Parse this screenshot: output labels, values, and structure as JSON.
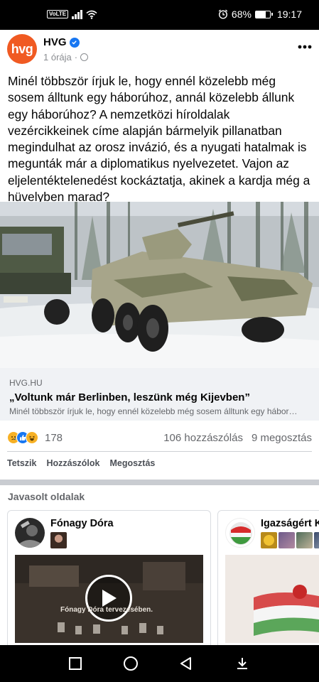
{
  "status_bar": {
    "network_label": "VoLTE",
    "battery_text": "68%",
    "battery_level": 0.68,
    "time": "19:17"
  },
  "post": {
    "author": "HVG",
    "avatar_text": "hvg",
    "time_ago": "1 órája",
    "separator": "·",
    "more_icon": "more-dots-icon",
    "text": "Minél többször írjuk le, hogy ennél közelebb még sosem álltunk egy háborúhoz, annál közelebb állunk egy háborúhoz? A nemzetközi híroldalak vezércikkeinek címe alapján bármelyik pillanatban megindulhat az orosz invázió, és a nyugati hatalmak is megunták már a diplomatikus nyelvezetet. Vajon az eljelentéktelenedést kockáztatja, akinek a kardja még a hüvelyben marad?",
    "image_icon": "armored-vehicles-photo",
    "link": {
      "domain": "HVG.HU",
      "title": "„Voltunk már Berlinben, leszünk még Kijevben”",
      "description": "Minél többször írjuk le, hogy ennél közelebb még sosem álltunk egy hábor…"
    },
    "reaction_count": "178",
    "comments_count": "106 hozzászólás",
    "shares_count": "9 megosztás",
    "actions": {
      "like": "Tetszik",
      "comment": "Hozzászólok",
      "share": "Megosztás"
    }
  },
  "suggested": {
    "title": "Javasolt oldalak",
    "cards": [
      {
        "name": "Fónagy Dóra",
        "video_caption": "Fónagy Dóra tervezésében."
      },
      {
        "name": "Igazságért K"
      }
    ]
  },
  "colors": {
    "brand_orange": "#f05a22",
    "facebook_blue": "#1877f2",
    "text_secondary": "#65676b"
  }
}
